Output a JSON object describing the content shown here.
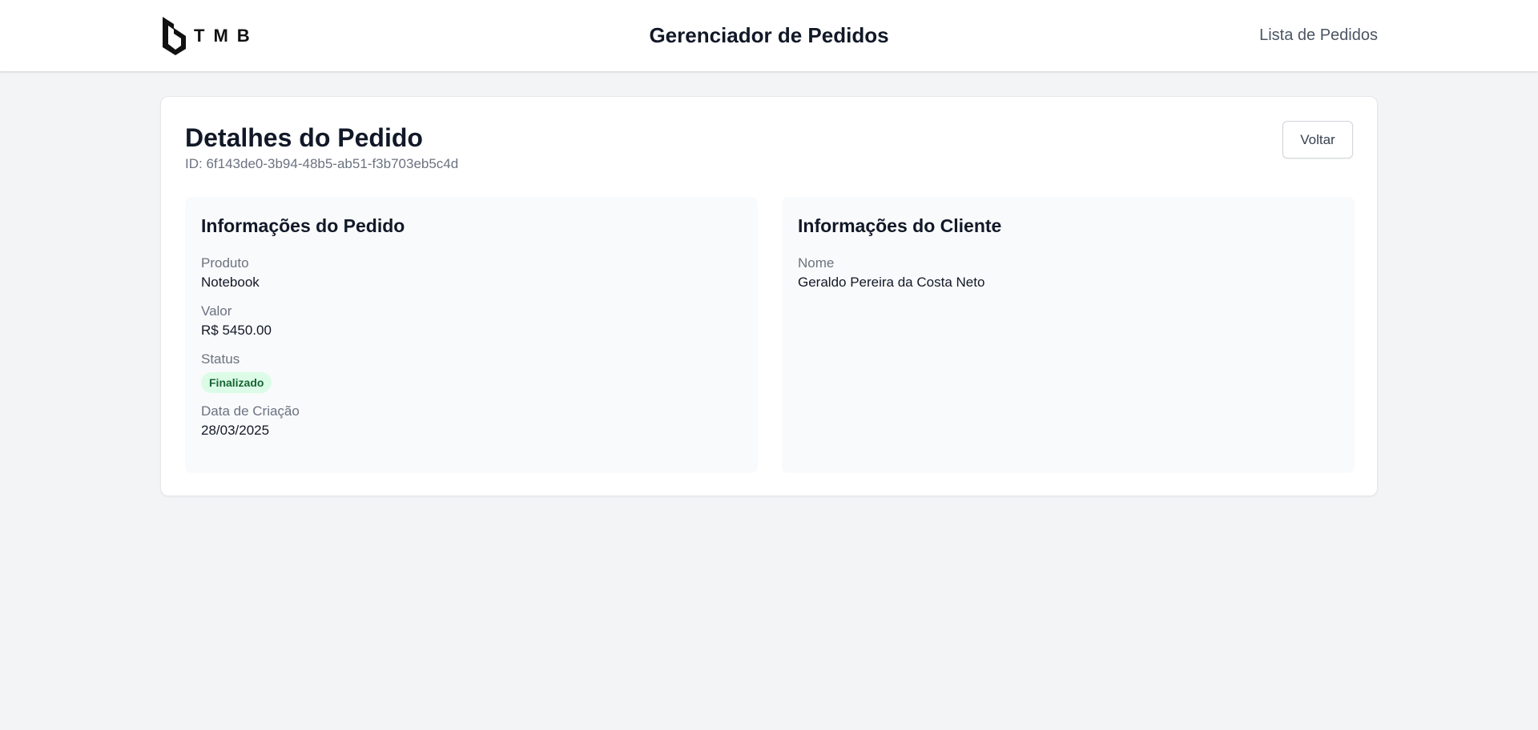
{
  "navbar": {
    "logo_text": "TMB",
    "app_title": "Gerenciador de Pedidos",
    "link_orders": "Lista de Pedidos"
  },
  "page": {
    "title": "Detalhes do Pedido",
    "id_text": "ID: 6f143de0-3b94-48b5-ab51-f3b703eb5c4d",
    "back_label": "Voltar"
  },
  "order_info": {
    "title": "Informações do Pedido",
    "product_label": "Produto",
    "product_value": "Notebook",
    "value_label": "Valor",
    "value_value": "R$ 5450.00",
    "status_label": "Status",
    "status_value": "Finalizado",
    "created_label": "Data de Criação",
    "created_value": "28/03/2025"
  },
  "client_info": {
    "title": "Informações do Cliente",
    "name_label": "Nome",
    "name_value": "Geraldo Pereira da Costa Neto"
  },
  "colors": {
    "background": "#f3f4f6",
    "status_badge_bg": "#dcfce7",
    "status_badge_text": "#166534"
  },
  "icons": {
    "logo": "tmb-logo-icon"
  }
}
